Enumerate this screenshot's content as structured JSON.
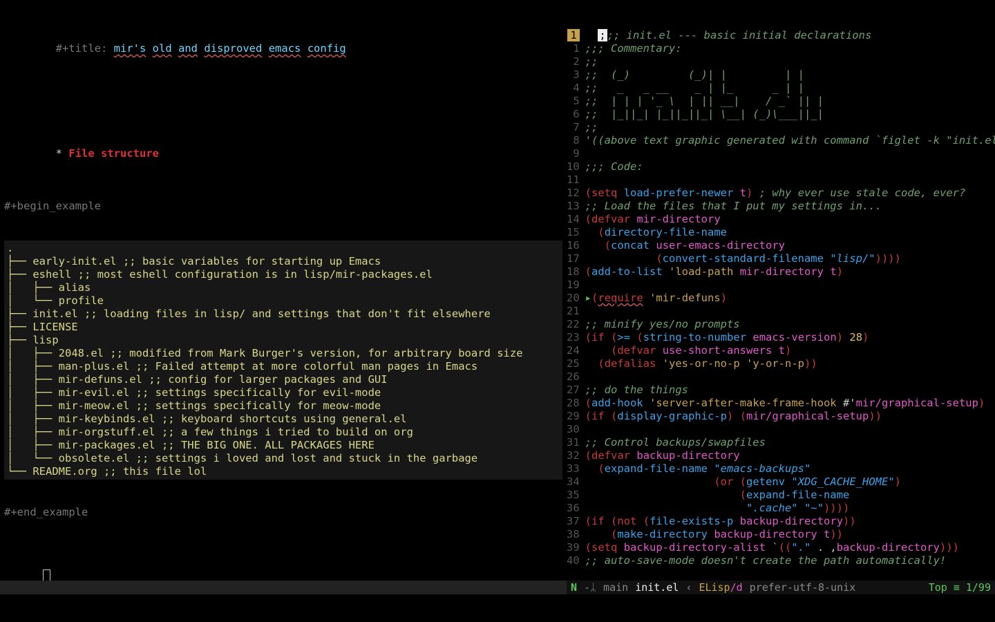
{
  "org": {
    "title_kw": "#+title: ",
    "title_words": [
      "mir's",
      "old",
      "and",
      "disproved",
      "emacs",
      "config"
    ],
    "heading_star": "* ",
    "heading_text": "File structure",
    "begin_example": "#+begin_example",
    "end_example": "#+end_example",
    "tree": [
      ".",
      "├── early-init.el ;; basic variables for starting up Emacs",
      "├── eshell ;; most eshell configuration is in lisp/mir-packages.el",
      "│   ├── alias",
      "│   └── profile",
      "├── init.el ;; loading files in lisp/ and settings that don't fit elsewhere",
      "├── LICENSE",
      "├── lisp",
      "│   ├── 2048.el ;; modified from Mark Burger's version, for arbitrary board size",
      "│   ├── man-plus.el ;; Failed attempt at more colorful man pages in Emacs",
      "│   ├── mir-defuns.el ;; config for larger packages and GUI",
      "│   ├── mir-evil.el ;; settings specifically for evil-mode",
      "│   ├── mir-meow.el ;; settings specifically for meow-mode",
      "│   ├── mir-keybinds.el ;; keyboard shortcuts using general.el",
      "│   ├── mir-orgstuff.el ;; a few things i tried to build on org",
      "│   ├── mir-packages.el ;; THE BIG ONE. ALL PACKAGES HERE",
      "│   └── obsolete.el ;; settings i loved and lost and stuck in the garbage",
      "└── README.org ;; this file lol"
    ]
  },
  "code": {
    "header_line_num": "1",
    "cursor_char": ";",
    "lines": [
      {
        "n": "",
        "segs": [
          {
            "c": "comment",
            "t": ";; init.el --- basic initial declarations"
          }
        ]
      },
      {
        "n": "1",
        "segs": [
          {
            "c": "comment",
            "t": ";;; Commentary:"
          }
        ]
      },
      {
        "n": "2",
        "segs": [
          {
            "c": "comment",
            "t": ";;"
          }
        ]
      },
      {
        "n": "3",
        "segs": [
          {
            "c": "comment",
            "t": ";;  (_)         (_)| |         | |"
          }
        ]
      },
      {
        "n": "4",
        "segs": [
          {
            "c": "comment",
            "t": ";;   _   _ __    _ | |_      _ | |"
          }
        ]
      },
      {
        "n": "5",
        "segs": [
          {
            "c": "comment",
            "t": ";;  | | | '_ \\  | || __|    / _` || |"
          }
        ]
      },
      {
        "n": "6",
        "segs": [
          {
            "c": "comment",
            "t": ";;  |_||_| |_||_||_| \\__| (_)\\___||_|"
          }
        ]
      },
      {
        "n": "7",
        "segs": [
          {
            "c": "comment",
            "t": ";;"
          }
        ]
      },
      {
        "n": "8",
        "segs": [
          {
            "c": "comment",
            "t": "'((above text graphic generated with command `figlet -k \"init.el\"'))"
          }
        ]
      },
      {
        "n": "9",
        "segs": [
          {
            "c": "",
            "t": ""
          }
        ]
      },
      {
        "n": "10",
        "segs": [
          {
            "c": "comment",
            "t": ";;; Code:"
          }
        ]
      },
      {
        "n": "11",
        "segs": [
          {
            "c": "",
            "t": ""
          }
        ]
      },
      {
        "n": "12",
        "segs": [
          {
            "c": "paren",
            "t": "("
          },
          {
            "c": "keyword",
            "t": "setq"
          },
          {
            "c": "",
            "t": " "
          },
          {
            "c": "func",
            "t": "load-prefer-newer"
          },
          {
            "c": "",
            "t": " "
          },
          {
            "c": "const",
            "t": "t"
          },
          {
            "c": "paren",
            "t": ")"
          },
          {
            "c": "",
            "t": " "
          },
          {
            "c": "comment",
            "t": "; why ever use stale code, ever?"
          }
        ]
      },
      {
        "n": "13",
        "segs": [
          {
            "c": "comment",
            "t": ";; Load the files that I put my settings in..."
          }
        ]
      },
      {
        "n": "14",
        "segs": [
          {
            "c": "paren",
            "t": "("
          },
          {
            "c": "keyword",
            "t": "defvar"
          },
          {
            "c": "",
            "t": " "
          },
          {
            "c": "varname",
            "t": "mir-directory"
          }
        ]
      },
      {
        "n": "15",
        "segs": [
          {
            "c": "",
            "t": "  "
          },
          {
            "c": "paren",
            "t": "("
          },
          {
            "c": "builtin",
            "t": "directory-file-name"
          }
        ]
      },
      {
        "n": "16",
        "segs": [
          {
            "c": "",
            "t": "   "
          },
          {
            "c": "paren",
            "t": "("
          },
          {
            "c": "builtin",
            "t": "concat"
          },
          {
            "c": "",
            "t": " "
          },
          {
            "c": "varname",
            "t": "user-emacs-directory"
          }
        ]
      },
      {
        "n": "17",
        "segs": [
          {
            "c": "",
            "t": "           "
          },
          {
            "c": "paren",
            "t": "("
          },
          {
            "c": "builtin",
            "t": "convert-standard-filename"
          },
          {
            "c": "",
            "t": " "
          },
          {
            "c": "string",
            "t": "\"lisp/\""
          },
          {
            "c": "paren",
            "t": "))))"
          }
        ]
      },
      {
        "n": "18",
        "segs": [
          {
            "c": "paren",
            "t": "("
          },
          {
            "c": "builtin",
            "t": "add-to-list"
          },
          {
            "c": "",
            "t": " "
          },
          {
            "c": "kw2",
            "t": "'load-path"
          },
          {
            "c": "",
            "t": " "
          },
          {
            "c": "varname",
            "t": "mir-directory"
          },
          {
            "c": "",
            "t": " "
          },
          {
            "c": "const",
            "t": "t"
          },
          {
            "c": "paren",
            "t": ")"
          }
        ]
      },
      {
        "n": "19",
        "segs": [
          {
            "c": "",
            "t": ""
          }
        ]
      },
      {
        "n": "20",
        "arrow": true,
        "segs": [
          {
            "c": "paren",
            "t": "("
          },
          {
            "c": "require",
            "t": "require"
          },
          {
            "c": "",
            "t": " "
          },
          {
            "c": "kw2",
            "t": "'mir-defuns"
          },
          {
            "c": "paren",
            "t": ")"
          }
        ]
      },
      {
        "n": "21",
        "segs": [
          {
            "c": "",
            "t": ""
          }
        ]
      },
      {
        "n": "22",
        "segs": [
          {
            "c": "comment",
            "t": ";; minify yes/no prompts"
          }
        ]
      },
      {
        "n": "23",
        "segs": [
          {
            "c": "paren",
            "t": "("
          },
          {
            "c": "keyword",
            "t": "if"
          },
          {
            "c": "",
            "t": " "
          },
          {
            "c": "paren",
            "t": "("
          },
          {
            "c": "builtin",
            "t": ">="
          },
          {
            "c": "",
            "t": " "
          },
          {
            "c": "paren",
            "t": "("
          },
          {
            "c": "builtin",
            "t": "string-to-number"
          },
          {
            "c": "",
            "t": " "
          },
          {
            "c": "varname",
            "t": "emacs-version"
          },
          {
            "c": "paren",
            "t": ")"
          },
          {
            "c": "",
            "t": " "
          },
          {
            "c": "number",
            "t": "28"
          },
          {
            "c": "paren",
            "t": ")"
          }
        ]
      },
      {
        "n": "24",
        "segs": [
          {
            "c": "",
            "t": "    "
          },
          {
            "c": "paren",
            "t": "("
          },
          {
            "c": "keyword",
            "t": "defvar"
          },
          {
            "c": "",
            "t": " "
          },
          {
            "c": "varname",
            "t": "use-short-answers"
          },
          {
            "c": "",
            "t": " "
          },
          {
            "c": "const",
            "t": "t"
          },
          {
            "c": "paren",
            "t": ")"
          }
        ]
      },
      {
        "n": "25",
        "segs": [
          {
            "c": "",
            "t": "  "
          },
          {
            "c": "paren",
            "t": "("
          },
          {
            "c": "keyword",
            "t": "defalias"
          },
          {
            "c": "",
            "t": " "
          },
          {
            "c": "kw2",
            "t": "'yes-or-no-p"
          },
          {
            "c": "",
            "t": " "
          },
          {
            "c": "kw2",
            "t": "'y-or-n-p"
          },
          {
            "c": "paren",
            "t": "))"
          }
        ]
      },
      {
        "n": "26",
        "segs": [
          {
            "c": "",
            "t": ""
          }
        ]
      },
      {
        "n": "27",
        "segs": [
          {
            "c": "comment",
            "t": ";; do the things"
          }
        ]
      },
      {
        "n": "28",
        "segs": [
          {
            "c": "paren",
            "t": "("
          },
          {
            "c": "builtin",
            "t": "add-hook"
          },
          {
            "c": "",
            "t": " "
          },
          {
            "c": "kw2",
            "t": "'server-after-make-frame-hook"
          },
          {
            "c": "",
            "t": " #'"
          },
          {
            "c": "varname",
            "t": "mir/graphical-setup"
          },
          {
            "c": "paren",
            "t": ")"
          }
        ]
      },
      {
        "n": "29",
        "segs": [
          {
            "c": "paren",
            "t": "("
          },
          {
            "c": "keyword",
            "t": "if"
          },
          {
            "c": "",
            "t": " "
          },
          {
            "c": "paren",
            "t": "("
          },
          {
            "c": "builtin",
            "t": "display-graphic-p"
          },
          {
            "c": "paren",
            "t": ")"
          },
          {
            "c": "",
            "t": " "
          },
          {
            "c": "paren",
            "t": "("
          },
          {
            "c": "varname",
            "t": "mir/graphical-setup"
          },
          {
            "c": "paren",
            "t": "))"
          }
        ]
      },
      {
        "n": "30",
        "segs": [
          {
            "c": "",
            "t": ""
          }
        ]
      },
      {
        "n": "31",
        "segs": [
          {
            "c": "comment",
            "t": ";; Control backups/swapfiles"
          }
        ]
      },
      {
        "n": "32",
        "segs": [
          {
            "c": "paren",
            "t": "("
          },
          {
            "c": "keyword",
            "t": "defvar"
          },
          {
            "c": "",
            "t": " "
          },
          {
            "c": "varname",
            "t": "backup-directory"
          }
        ]
      },
      {
        "n": "33",
        "segs": [
          {
            "c": "",
            "t": "  "
          },
          {
            "c": "paren",
            "t": "("
          },
          {
            "c": "builtin",
            "t": "expand-file-name"
          },
          {
            "c": "",
            "t": " "
          },
          {
            "c": "string",
            "t": "\"emacs-backups\""
          }
        ]
      },
      {
        "n": "34",
        "segs": [
          {
            "c": "",
            "t": "                    "
          },
          {
            "c": "paren",
            "t": "("
          },
          {
            "c": "keyword",
            "t": "or"
          },
          {
            "c": "",
            "t": " "
          },
          {
            "c": "paren",
            "t": "("
          },
          {
            "c": "builtin",
            "t": "getenv"
          },
          {
            "c": "",
            "t": " "
          },
          {
            "c": "string",
            "t": "\"XDG_CACHE_HOME\""
          },
          {
            "c": "paren",
            "t": ")"
          }
        ]
      },
      {
        "n": "35",
        "segs": [
          {
            "c": "",
            "t": "                        "
          },
          {
            "c": "paren",
            "t": "("
          },
          {
            "c": "builtin",
            "t": "expand-file-name"
          }
        ]
      },
      {
        "n": "36",
        "segs": [
          {
            "c": "",
            "t": "                         "
          },
          {
            "c": "string",
            "t": "\".cache\""
          },
          {
            "c": "",
            "t": " "
          },
          {
            "c": "string",
            "t": "\"~\""
          },
          {
            "c": "paren",
            "t": "))))"
          }
        ]
      },
      {
        "n": "37",
        "segs": [
          {
            "c": "paren",
            "t": "("
          },
          {
            "c": "keyword",
            "t": "if"
          },
          {
            "c": "",
            "t": " "
          },
          {
            "c": "paren",
            "t": "("
          },
          {
            "c": "keyword",
            "t": "not"
          },
          {
            "c": "",
            "t": " "
          },
          {
            "c": "paren",
            "t": "("
          },
          {
            "c": "builtin",
            "t": "file-exists-p"
          },
          {
            "c": "",
            "t": " "
          },
          {
            "c": "varname",
            "t": "backup-directory"
          },
          {
            "c": "paren",
            "t": "))"
          }
        ]
      },
      {
        "n": "38",
        "segs": [
          {
            "c": "",
            "t": "    "
          },
          {
            "c": "paren",
            "t": "("
          },
          {
            "c": "builtin",
            "t": "make-directory"
          },
          {
            "c": "",
            "t": " "
          },
          {
            "c": "varname",
            "t": "backup-directory"
          },
          {
            "c": "",
            "t": " "
          },
          {
            "c": "const",
            "t": "t"
          },
          {
            "c": "paren",
            "t": "))"
          }
        ]
      },
      {
        "n": "39",
        "segs": [
          {
            "c": "paren",
            "t": "("
          },
          {
            "c": "keyword",
            "t": "setq"
          },
          {
            "c": "",
            "t": " "
          },
          {
            "c": "varname",
            "t": "backup-directory-alist"
          },
          {
            "c": "",
            "t": " "
          },
          {
            "c": "kw2",
            "t": "`"
          },
          {
            "c": "paren",
            "t": "(("
          },
          {
            "c": "string",
            "t": "\".\""
          },
          {
            "c": "",
            "t": " . ,"
          },
          {
            "c": "varname",
            "t": "backup-directory"
          },
          {
            "c": "paren",
            "t": ")))"
          }
        ]
      },
      {
        "n": "40",
        "segs": [
          {
            "c": "comment",
            "t": ";; auto-save-mode doesn't create the path automatically!"
          }
        ]
      }
    ]
  },
  "modeline": {
    "state": "N",
    "branch_icon": "-ᛦ",
    "branch": "main",
    "file": "init.el",
    "sep": "‹",
    "mode": "ELisp",
    "mode_suffix": "/d",
    "encoding": "prefer-utf-8-unix",
    "pos": "Top ≡ 1/99"
  }
}
